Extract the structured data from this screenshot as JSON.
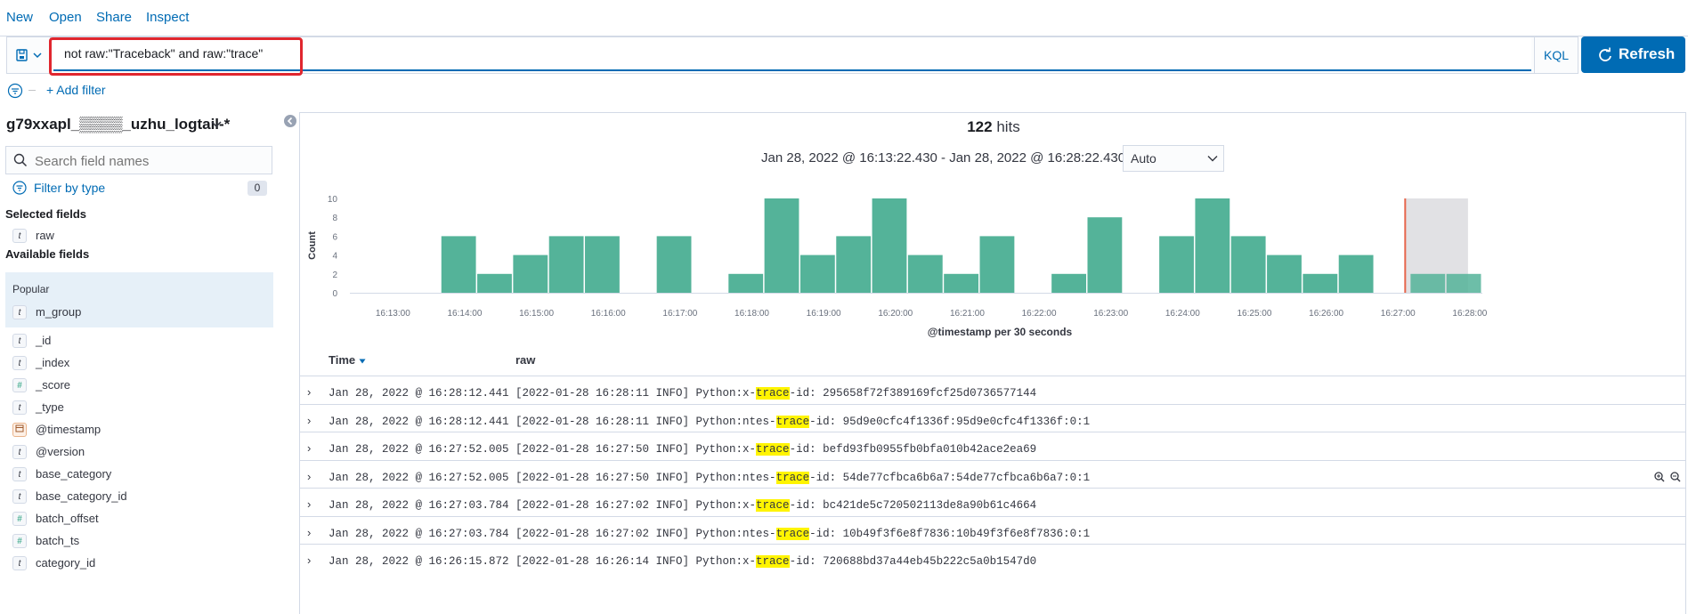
{
  "top_menu": [
    "New",
    "Open",
    "Share",
    "Inspect"
  ],
  "query": {
    "value": "not raw:\"Traceback\" and raw:\"trace\"",
    "language": "KQL",
    "refresh_label": "Refresh"
  },
  "filters": {
    "add_label": "+ Add filter"
  },
  "sidebar": {
    "index_pattern": "g79xxapl_▒▒▒▒_uzhu_logtail-*",
    "search_placeholder": "Search field names",
    "filter_by_type": "Filter by type",
    "filter_count": "0",
    "selected_title": "Selected fields",
    "selected_fields": [
      {
        "type": "t",
        "name": "raw"
      }
    ],
    "available_title": "Available fields",
    "popular_title": "Popular",
    "popular_fields": [
      {
        "type": "t",
        "name": "m_group"
      }
    ],
    "available_fields": [
      {
        "type": "t",
        "name": "_id"
      },
      {
        "type": "t",
        "name": "_index"
      },
      {
        "type": "#",
        "name": "_score"
      },
      {
        "type": "t",
        "name": "_type"
      },
      {
        "type": "date",
        "name": "@timestamp"
      },
      {
        "type": "t",
        "name": "@version"
      },
      {
        "type": "t",
        "name": "base_category"
      },
      {
        "type": "t",
        "name": "base_category_id"
      },
      {
        "type": "#",
        "name": "batch_offset"
      },
      {
        "type": "#",
        "name": "batch_ts"
      },
      {
        "type": "t",
        "name": "category_id"
      }
    ]
  },
  "hits": {
    "count": "122",
    "label": "hits"
  },
  "time_range": "Jan 28, 2022 @ 16:13:22.430 - Jan 28, 2022 @ 16:28:22.430",
  "interval": "Auto",
  "colors": {
    "bar": "#54b399",
    "accent": "#006bb4",
    "now_line": "#e7664c",
    "partial_bg": "#e1e1e4"
  },
  "chart_data": {
    "type": "bar",
    "xlabel": "@timestamp per 30 seconds",
    "ylabel": "Count",
    "ylim": [
      0,
      10
    ],
    "y_ticks": [
      "0",
      "2",
      "4",
      "6",
      "8",
      "10"
    ],
    "x_tick_labels": [
      "16:13:00",
      "16:14:00",
      "16:15:00",
      "16:16:00",
      "16:17:00",
      "16:18:00",
      "16:19:00",
      "16:20:00",
      "16:21:00",
      "16:22:00",
      "16:23:00",
      "16:24:00",
      "16:25:00",
      "16:26:00",
      "16:27:00",
      "16:28:00"
    ],
    "categories": [
      "16:13:00",
      "16:13:30",
      "16:14:00",
      "16:14:30",
      "16:15:00",
      "16:15:30",
      "16:16:00",
      "16:16:30",
      "16:17:00",
      "16:17:30",
      "16:18:00",
      "16:18:30",
      "16:19:00",
      "16:19:30",
      "16:20:00",
      "16:20:30",
      "16:21:00",
      "16:21:30",
      "16:22:00",
      "16:22:30",
      "16:23:00",
      "16:23:30",
      "16:24:00",
      "16:24:30",
      "16:25:00",
      "16:25:30",
      "16:26:00",
      "16:26:30",
      "16:27:00",
      "16:27:30",
      "16:28:00"
    ],
    "values": [
      0,
      0,
      6,
      2,
      4,
      6,
      6,
      0,
      6,
      0,
      2,
      10,
      4,
      6,
      10,
      4,
      2,
      6,
      0,
      2,
      8,
      0,
      6,
      10,
      6,
      4,
      2,
      4,
      0,
      2,
      2
    ],
    "now_marker": "16:27:22.430"
  },
  "table": {
    "time_header": "Time",
    "raw_header": "raw",
    "rows": [
      {
        "time": "Jan 28, 2022 @ 16:28:12.441",
        "pre": "[2022-01-28 16:28:11 INFO] Python:x-",
        "hl": "trace",
        "post": "-id: 295658f72f389169fcf25d0736577144"
      },
      {
        "time": "Jan 28, 2022 @ 16:28:12.441",
        "pre": "[2022-01-28 16:28:11 INFO] Python:ntes-",
        "hl": "trace",
        "post": "-id: 95d9e0cfc4f1336f:95d9e0cfc4f1336f:0:1"
      },
      {
        "time": "Jan 28, 2022 @ 16:27:52.005",
        "pre": "[2022-01-28 16:27:50 INFO] Python:x-",
        "hl": "trace",
        "post": "-id: befd93fb0955fb0bfa010b42ace2ea69"
      },
      {
        "time": "Jan 28, 2022 @ 16:27:52.005",
        "pre": "[2022-01-28 16:27:50 INFO] Python:ntes-",
        "hl": "trace",
        "post": "-id: 54de77cfbca6b6a7:54de77cfbca6b6a7:0:1"
      },
      {
        "time": "Jan 28, 2022 @ 16:27:03.784",
        "pre": "[2022-01-28 16:27:02 INFO] Python:x-",
        "hl": "trace",
        "post": "-id: bc421de5c720502113de8a90b61c4664"
      },
      {
        "time": "Jan 28, 2022 @ 16:27:03.784",
        "pre": "[2022-01-28 16:27:02 INFO] Python:ntes-",
        "hl": "trace",
        "post": "-id: 10b49f3f6e8f7836:10b49f3f6e8f7836:0:1"
      },
      {
        "time": "Jan 28, 2022 @ 16:26:15.872",
        "pre": "[2022-01-28 16:26:14 INFO] Python:x-",
        "hl": "trace",
        "post": "-id: 720688bd37a44eb45b222c5a0b1547d0"
      }
    ]
  }
}
